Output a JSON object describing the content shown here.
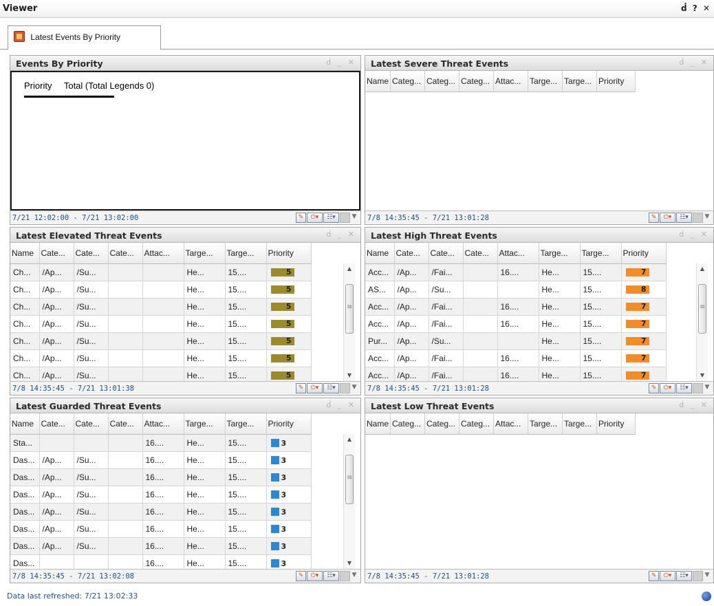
{
  "viewer": {
    "title": "Viewer",
    "controls": "ḋ ? ✕"
  },
  "tab": {
    "label": "Latest Events By Priority"
  },
  "chart_data": {
    "type": "pie",
    "title": "Events By Priority",
    "legend_headers": [
      "Priority",
      "Total (Total Legends 0)"
    ],
    "values": [],
    "categories": []
  },
  "panels": {
    "events_by_priority": {
      "title": "Events By Priority",
      "range": "7/21 12:02:00 - 7/21 13:02:00"
    },
    "severe": {
      "title": "Latest Severe Threat Events",
      "range": "7/8 14:35:45 - 7/21 13:01:28",
      "columns": [
        "Name",
        "Categ...",
        "Categ...",
        "Categ...",
        "Attac...",
        "Targe...",
        "Targe...",
        "Priority"
      ],
      "rows": []
    },
    "elevated": {
      "title": "Latest Elevated Threat Events",
      "range": "7/8 14:35:45 - 7/21 13:01:38",
      "columns": [
        "Name",
        "Cate...",
        "Cate...",
        "Cate...",
        "Attac...",
        "Targe...",
        "Targe...",
        "Priority"
      ],
      "priority_color": "#9b8a2e",
      "rows": [
        [
          "Ch...",
          "/Ap...",
          "/Su...",
          "",
          "",
          "He...",
          "15....",
          "5"
        ],
        [
          "Ch...",
          "/Ap...",
          "/Su...",
          "",
          "",
          "He...",
          "15....",
          "5"
        ],
        [
          "Ch...",
          "/Ap...",
          "/Su...",
          "",
          "",
          "He...",
          "15....",
          "5"
        ],
        [
          "Ch...",
          "/Ap...",
          "/Su...",
          "",
          "",
          "He...",
          "15....",
          "5"
        ],
        [
          "Ch...",
          "/Ap...",
          "/Su...",
          "",
          "",
          "He...",
          "15....",
          "5"
        ],
        [
          "Ch...",
          "/Ap...",
          "/Su...",
          "",
          "",
          "He...",
          "15....",
          "5"
        ],
        [
          "Ch...",
          "/Ap...",
          "/Su...",
          "",
          "",
          "He...",
          "15....",
          "5"
        ]
      ]
    },
    "high": {
      "title": "Latest High Threat Events",
      "range": "7/8 14:35:45 - 7/21 13:01:28",
      "columns": [
        "Name",
        "Cate...",
        "Cate...",
        "Cate...",
        "Attac...",
        "Targe...",
        "Targe...",
        "Priority"
      ],
      "priority_color": "#f28c28",
      "rows": [
        [
          "Acc...",
          "/Ap...",
          "/Fai...",
          "",
          "16....",
          "He...",
          "15....",
          "7"
        ],
        [
          "AS...",
          "/Ap...",
          "/Su...",
          "",
          "",
          "He...",
          "15....",
          "8"
        ],
        [
          "Acc...",
          "/Ap...",
          "/Fai...",
          "",
          "16....",
          "He...",
          "15....",
          "7"
        ],
        [
          "Acc...",
          "/Ap...",
          "/Fai...",
          "",
          "16....",
          "He...",
          "15....",
          "7"
        ],
        [
          "Pur...",
          "/Ap...",
          "/Su...",
          "",
          "",
          "He...",
          "15....",
          "7"
        ],
        [
          "Acc...",
          "/Ap...",
          "/Fai...",
          "",
          "16....",
          "He...",
          "15....",
          "7"
        ],
        [
          "Acc...",
          "/Ap...",
          "/Fai...",
          "",
          "16....",
          "He...",
          "15....",
          "7"
        ]
      ]
    },
    "guarded": {
      "title": "Latest Guarded Threat Events",
      "range": "7/8 14:35:45 - 7/21 13:02:08",
      "columns": [
        "Name",
        "Cate...",
        "Cate...",
        "Cate...",
        "Attac...",
        "Targe...",
        "Targe...",
        "Priority"
      ],
      "priority_color": "#2f86d2",
      "rows": [
        [
          "Sta...",
          "",
          "",
          "",
          "16....",
          "He...",
          "15....",
          "3"
        ],
        [
          "Das...",
          "/Ap...",
          "/Su...",
          "",
          "16....",
          "He...",
          "15....",
          "3"
        ],
        [
          "Das...",
          "/Ap...",
          "/Su...",
          "",
          "16....",
          "He...",
          "15....",
          "3"
        ],
        [
          "Das...",
          "/Ap...",
          "/Su...",
          "",
          "16....",
          "He...",
          "15....",
          "3"
        ],
        [
          "Das...",
          "/Ap...",
          "/Su...",
          "",
          "16....",
          "He...",
          "15....",
          "3"
        ],
        [
          "Das...",
          "/Ap...",
          "/Su...",
          "",
          "16....",
          "He...",
          "15....",
          "3"
        ],
        [
          "Das...",
          "/Ap...",
          "/Su...",
          "",
          "16....",
          "He...",
          "15....",
          "3"
        ],
        [
          "Das...",
          "",
          "",
          "",
          "16....",
          "He...",
          "15....",
          "3"
        ]
      ]
    },
    "low": {
      "title": "Latest Low Threat Events",
      "range": "7/8 14:35:45 - 7/21 13:01:28",
      "columns": [
        "Name",
        "Categ...",
        "Categ...",
        "Categ...",
        "Attac...",
        "Targe...",
        "Targe...",
        "Priority"
      ],
      "rows": []
    }
  },
  "status": {
    "text": "Data last refreshed: 7/21 13:02:33"
  },
  "icons": {
    "panel_controls": "ḋ _ ✕",
    "scroll_up": "▲",
    "scroll_down": "▼",
    "dropdown": "▼"
  }
}
